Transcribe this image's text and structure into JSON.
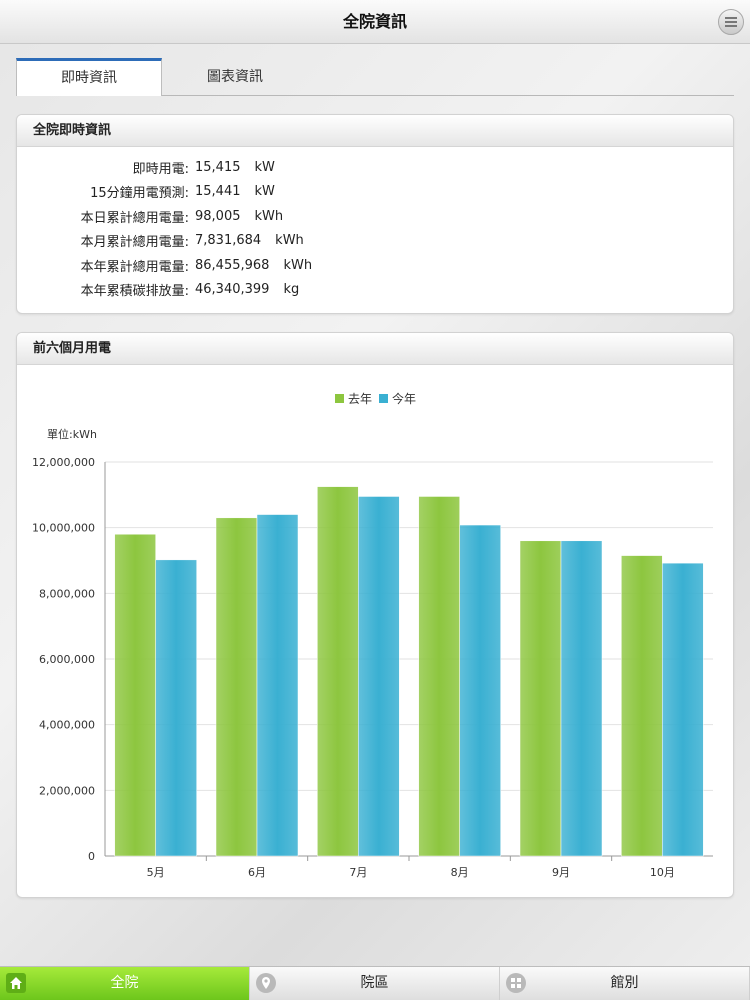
{
  "header": {
    "title": "全院資訊",
    "menu_icon": "menu-icon"
  },
  "tabs": [
    {
      "label": "即時資訊",
      "active": true
    },
    {
      "label": "圖表資訊",
      "active": false
    }
  ],
  "info_panel": {
    "title": "全院即時資訊",
    "rows": [
      {
        "label": "即時用電:",
        "value": "15,415",
        "unit": "kW"
      },
      {
        "label": "15分鐘用電預測:",
        "value": "15,441",
        "unit": "kW"
      },
      {
        "label": "本日累計總用電量:",
        "value": "98,005",
        "unit": "kWh"
      },
      {
        "label": "本月累計總用電量:",
        "value": "7,831,684",
        "unit": "kWh"
      },
      {
        "label": "本年累計總用電量:",
        "value": "86,455,968",
        "unit": "kWh"
      },
      {
        "label": "本年累積碳排放量:",
        "value": "46,340,399",
        "unit": "kg"
      }
    ]
  },
  "chart_panel": {
    "title": "前六個月用電"
  },
  "chart_data": {
    "type": "bar",
    "unit_label": "單位:kWh",
    "categories": [
      "5月",
      "6月",
      "7月",
      "8月",
      "9月",
      "10月"
    ],
    "ylim": [
      0,
      12000000
    ],
    "yticks": [
      0,
      2000000,
      4000000,
      6000000,
      8000000,
      10000000,
      12000000
    ],
    "ytick_labels": [
      "0",
      "2,000,000",
      "4,000,000",
      "6,000,000",
      "8,000,000",
      "10,000,000",
      "12,000,000"
    ],
    "grid": true,
    "legend_position": "top-center",
    "series": [
      {
        "name": "去年",
        "color": "#8dc63f",
        "values": [
          9800000,
          10300000,
          11250000,
          10950000,
          9600000,
          9150000
        ]
      },
      {
        "name": "今年",
        "color": "#3ab0d2",
        "values": [
          9020000,
          10400000,
          10950000,
          10080000,
          9600000,
          8920000
        ]
      }
    ]
  },
  "bottom_nav": [
    {
      "label": "全院",
      "icon": "home-icon",
      "active": true
    },
    {
      "label": "院區",
      "icon": "location-pin-icon",
      "active": false
    },
    {
      "label": "館別",
      "icon": "grid-icon",
      "active": false
    }
  ]
}
